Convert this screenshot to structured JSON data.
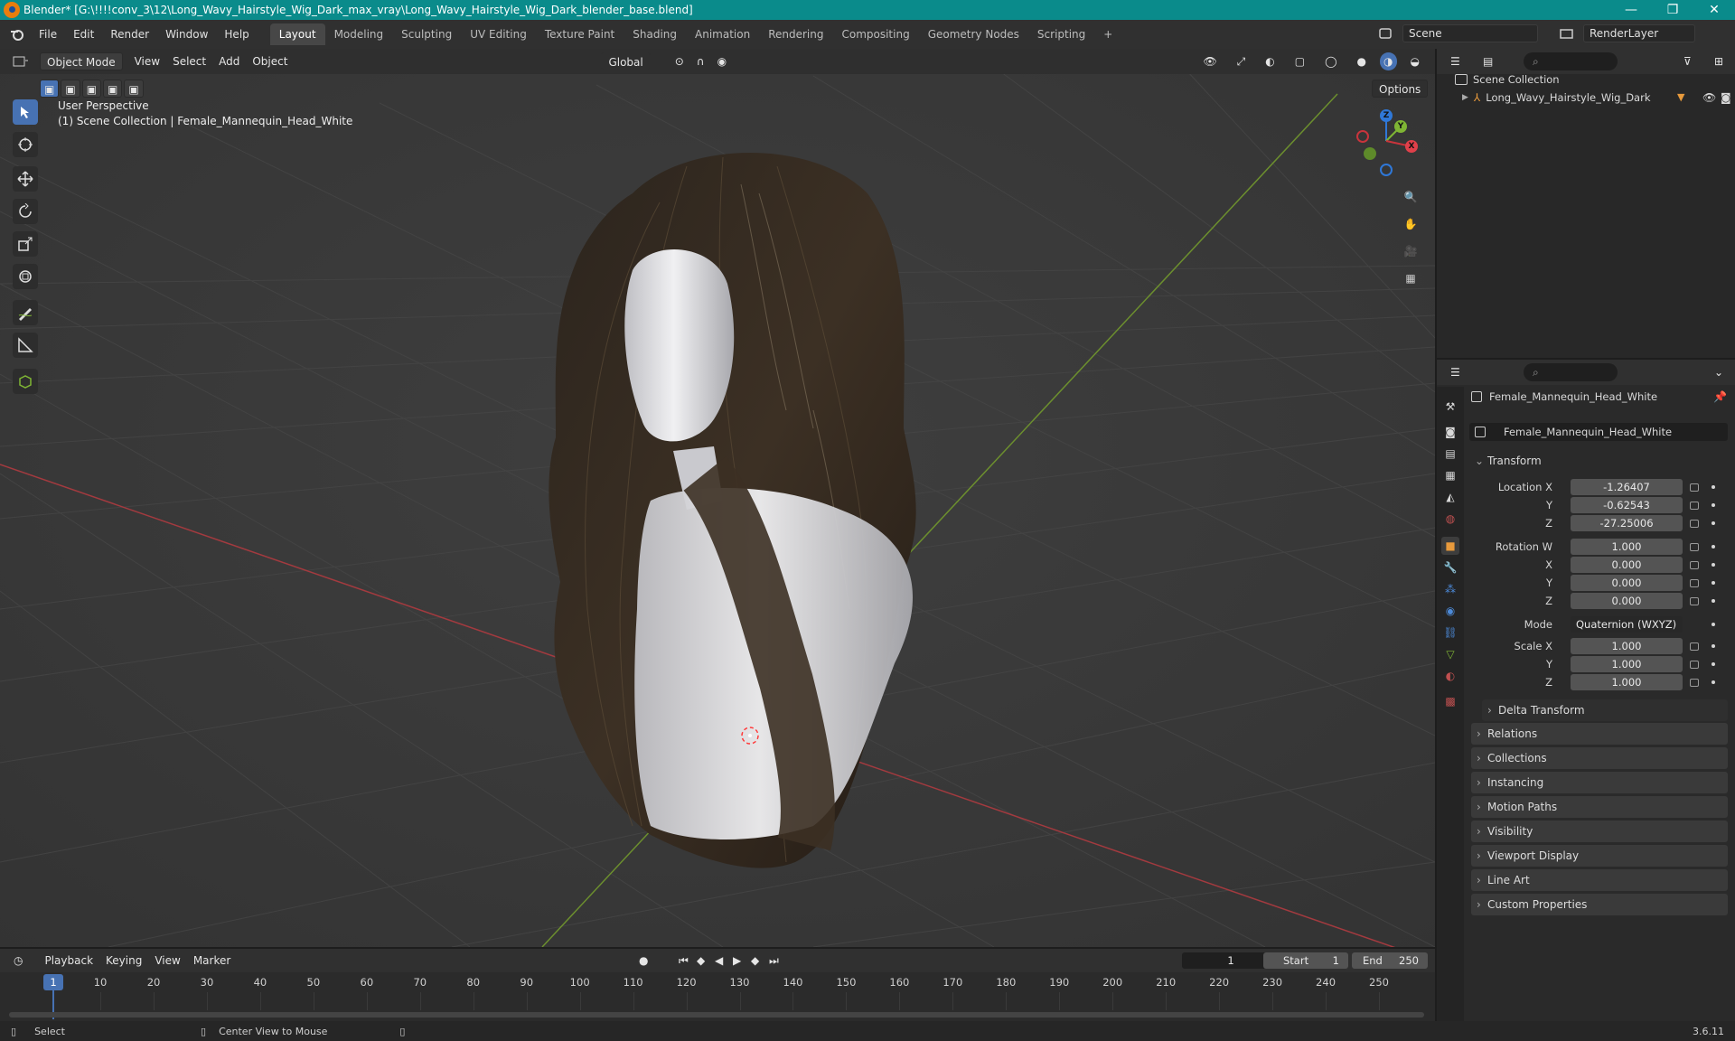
{
  "window": {
    "title": "Blender* [G:\\!!!!conv_3\\12\\Long_Wavy_Hairstyle_Wig_Dark_max_vray\\Long_Wavy_Hairstyle_Wig_Dark_blender_base.blend]",
    "minimize": "—",
    "maximize": "❐",
    "close": "✕"
  },
  "menu": {
    "items": [
      "File",
      "Edit",
      "Render",
      "Window",
      "Help"
    ],
    "workspaces": [
      "Layout",
      "Modeling",
      "Sculpting",
      "UV Editing",
      "Texture Paint",
      "Shading",
      "Animation",
      "Rendering",
      "Compositing",
      "Geometry Nodes",
      "Scripting"
    ],
    "active_workspace": "Layout",
    "add_tab": "+",
    "scene": "Scene",
    "view_layer": "RenderLayer"
  },
  "viewport": {
    "mode": "Object Mode",
    "menus": [
      "View",
      "Select",
      "Add",
      "Object"
    ],
    "orientation": "Global",
    "options": "Options",
    "perspective": "User Perspective",
    "collection_info": "(1) Scene Collection | Female_Mannequin_Head_White",
    "gizmo": {
      "x": "X",
      "y": "Y",
      "z": "Z"
    }
  },
  "outliner": {
    "root": "Scene Collection",
    "items": [
      {
        "name": "Long_Wavy_Hairstyle_Wig_Dark"
      }
    ]
  },
  "properties": {
    "object_name": "Female_Mannequin_Head_White",
    "data_name": "Female_Mannequin_Head_White",
    "transform_label": "Transform",
    "location": {
      "label": "Location X",
      "x": "-1.26407",
      "y_label": "Y",
      "y": "-0.62543",
      "z_label": "Z",
      "z": "-27.25006"
    },
    "rotation": {
      "label": "Rotation W",
      "w": "1.000",
      "x_label": "X",
      "x": "0.000",
      "y_label": "Y",
      "y": "0.000",
      "z_label": "Z",
      "z": "0.000"
    },
    "mode": {
      "label": "Mode",
      "value": "Quaternion (WXYZ)"
    },
    "scale": {
      "label": "Scale X",
      "x": "1.000",
      "y_label": "Y",
      "y": "1.000",
      "z_label": "Z",
      "z": "1.000"
    },
    "delta_transform": "Delta Transform",
    "panels": [
      "Relations",
      "Collections",
      "Instancing",
      "Motion Paths",
      "Visibility",
      "Viewport Display",
      "Line Art",
      "Custom Properties"
    ]
  },
  "timeline": {
    "menus": [
      "Playback",
      "Keying",
      "View",
      "Marker"
    ],
    "current_frame": "1",
    "start_label": "Start",
    "start": "1",
    "end_label": "End",
    "end": "250",
    "ticks": [
      "1",
      "10",
      "20",
      "30",
      "40",
      "50",
      "60",
      "70",
      "80",
      "90",
      "100",
      "110",
      "120",
      "130",
      "140",
      "150",
      "160",
      "170",
      "180",
      "190",
      "200",
      "210",
      "220",
      "230",
      "240",
      "250"
    ]
  },
  "status": {
    "select": "Select",
    "center_view": "Center View to Mouse",
    "version": "3.6.11"
  },
  "colors": {
    "accent": "#4772b3",
    "titlebar": "#0a8b8b",
    "x_axis": "#c8343c",
    "y_axis": "#7fb534",
    "z_axis": "#2f78d8"
  }
}
